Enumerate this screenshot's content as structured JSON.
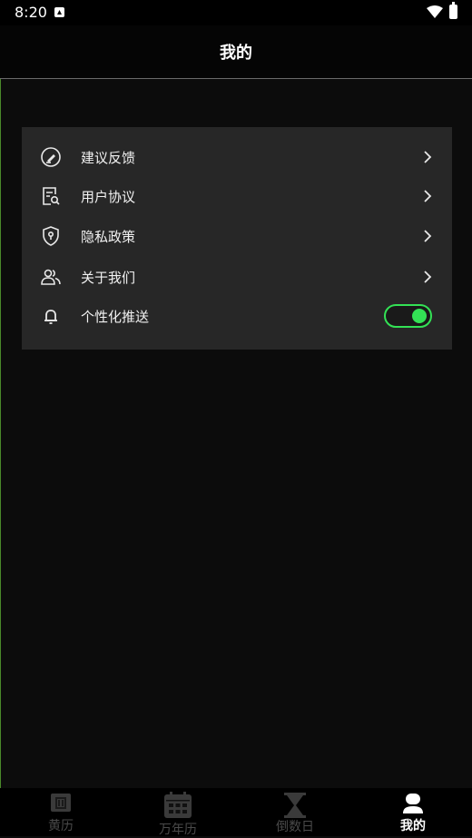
{
  "status": {
    "time": "8:20"
  },
  "header": {
    "title": "我的"
  },
  "menu": {
    "items": [
      {
        "label": "建议反馈",
        "icon": "edit-circle-icon"
      },
      {
        "label": "用户协议",
        "icon": "document-search-icon"
      },
      {
        "label": "隐私政策",
        "icon": "shield-lock-icon"
      },
      {
        "label": "关于我们",
        "icon": "users-icon"
      }
    ],
    "push": {
      "label": "个性化推送",
      "icon": "bell-icon",
      "enabled": true
    }
  },
  "tabs": [
    {
      "label": "黄历",
      "icon": "almanac-icon",
      "active": false
    },
    {
      "label": "万年历",
      "icon": "calendar-icon",
      "active": false
    },
    {
      "label": "倒数日",
      "icon": "hourglass-icon",
      "active": false
    },
    {
      "label": "我的",
      "icon": "profile-icon",
      "active": true
    }
  ],
  "colors": {
    "accent": "#33e255",
    "card": "#272727",
    "background": "#0c0c0c",
    "tab_inactive": "#4a4a4a"
  }
}
